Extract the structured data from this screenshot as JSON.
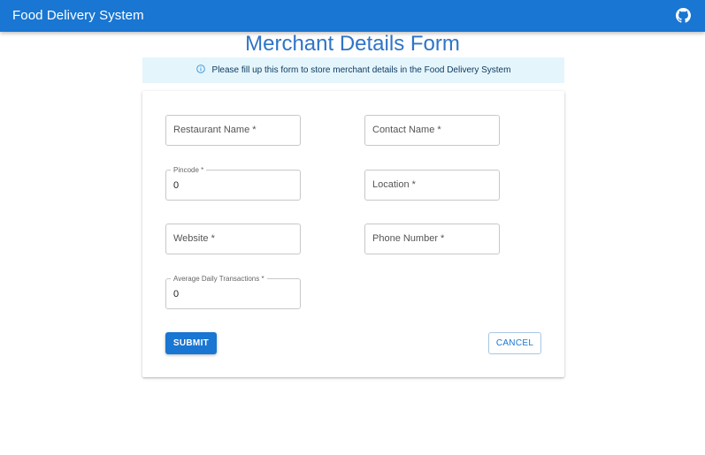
{
  "appbar": {
    "title": "Food Delivery System",
    "icon": "github-icon"
  },
  "page": {
    "title": "Merchant Details Form"
  },
  "alert": {
    "icon": "info-icon",
    "text": "Please fill up this form to store merchant details in the Food Delivery System"
  },
  "form": {
    "restaurant_name": {
      "label": "Restaurant Name *",
      "value": ""
    },
    "contact_name": {
      "label": "Contact Name *",
      "value": ""
    },
    "pincode": {
      "label": "Pincode *",
      "value": "0"
    },
    "location": {
      "label": "Location *",
      "value": ""
    },
    "website": {
      "label": "Website *",
      "value": ""
    },
    "phone_number": {
      "label": "Phone Number *",
      "value": ""
    },
    "average_daily_transactions": {
      "label": "Average Daily Transactions *",
      "value": "0"
    },
    "submit_label": "SUBMIT",
    "cancel_label": "CANCEL"
  },
  "colors": {
    "primary": "#1976d2",
    "title": "#2f74c8",
    "alert_bg": "#e5f5fc"
  }
}
